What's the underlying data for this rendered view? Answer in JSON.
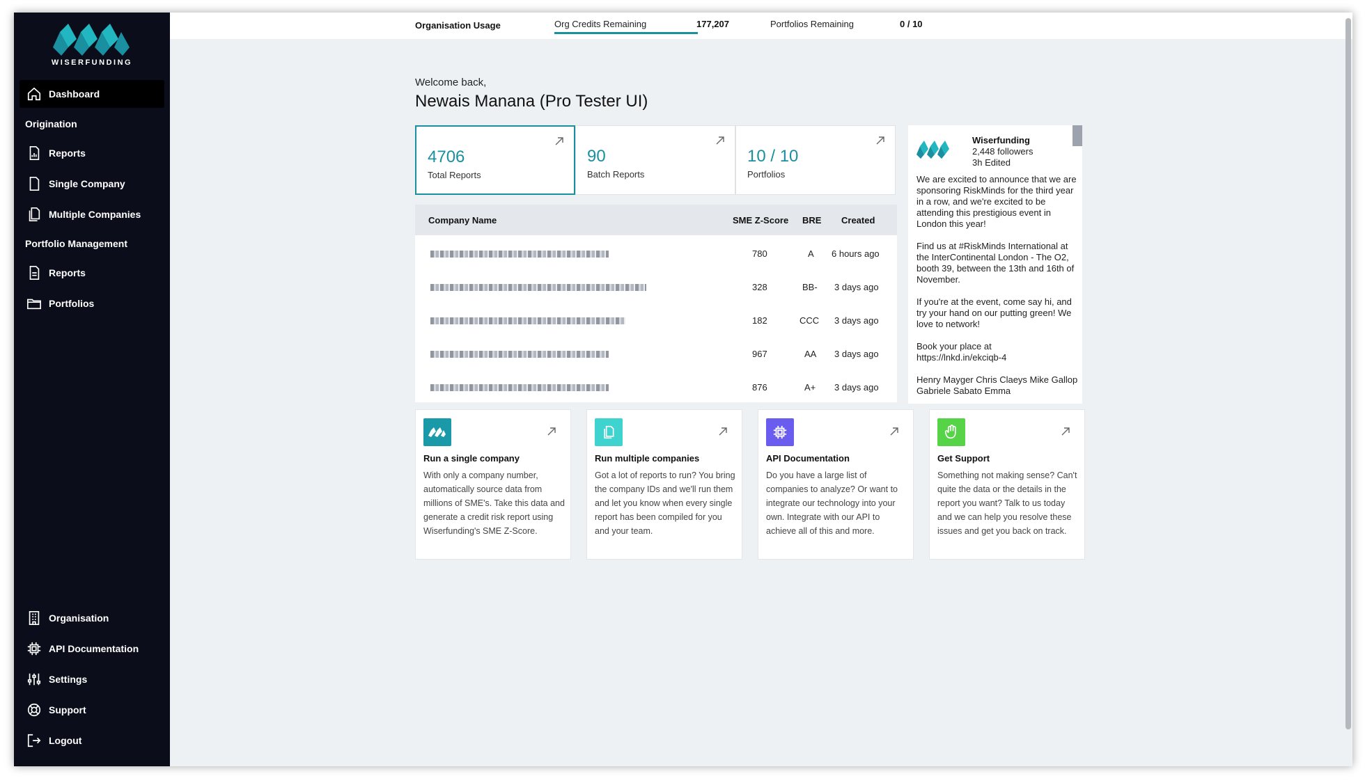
{
  "brand": {
    "name": "WISERFUNDING"
  },
  "sidebar": {
    "dashboard": "Dashboard",
    "section_origination": "Origination",
    "origination_items": [
      "Reports",
      "Single Company",
      "Multiple Companies"
    ],
    "section_portfolio": "Portfolio Management",
    "portfolio_items": [
      "Reports",
      "Portfolios"
    ],
    "bottom_items": [
      "Organisation",
      "API Documentation",
      "Settings",
      "Support",
      "Logout"
    ]
  },
  "topbar": {
    "title": "Organisation Usage",
    "credits_label": "Org Credits Remaining",
    "credits_value": "177,207",
    "portfolios_label": "Portfolios Remaining",
    "portfolios_value": "0 / 10"
  },
  "welcome": {
    "greeting": "Welcome back,",
    "name": "Newais Manana (Pro Tester UI)"
  },
  "stats": [
    {
      "value": "4706",
      "label": "Total Reports"
    },
    {
      "value": "90",
      "label": "Batch Reports"
    },
    {
      "value": "10 / 10",
      "label": "Portfolios"
    }
  ],
  "table": {
    "headers": {
      "company": "Company Name",
      "score": "SME Z-Score",
      "bre": "BRE",
      "created": "Created"
    },
    "rows": [
      {
        "score": "780",
        "bre": "A",
        "created": "6 hours ago"
      },
      {
        "score": "328",
        "bre": "BB-",
        "created": "3 days ago"
      },
      {
        "score": "182",
        "bre": "CCC",
        "created": "3 days ago"
      },
      {
        "score": "967",
        "bre": "AA",
        "created": "3 days ago"
      },
      {
        "score": "876",
        "bre": "A+",
        "created": "3 days ago"
      }
    ]
  },
  "feed": {
    "name": "Wiserfunding",
    "followers": "2,448 followers",
    "edited": "3h Edited",
    "paragraphs": [
      "We are excited to announce that we are sponsoring RiskMinds for the third year in a row, and we're excited to be attending this prestigious event in London this year!",
      "Find us at #RiskMinds International at the InterContinental London - The O2, booth 39, between the 13th and 16th of November.",
      "If you're at the event, come say hi, and try your hand on our putting green! We love to network!",
      "Book your place at https://lnkd.in/ekciqb-4",
      "Henry Mayger Chris Claeys Mike Gallop Gabriele Sabato Emma"
    ]
  },
  "cards": [
    {
      "title": "Run a single company",
      "desc": "With only a company number, automatically source data from millions of SME's. Take this data and generate a credit risk report using Wiserfunding's SME Z-Score.",
      "color": "#1a9aa8",
      "icon": "logo-icon"
    },
    {
      "title": "Run multiple companies",
      "desc": "Got a lot of reports to run? You bring the company IDs and we'll run them and let you know when every single report has been compiled for you and your team.",
      "color": "#3fd3cf",
      "icon": "copy-icon"
    },
    {
      "title": "API Documentation",
      "desc": "Do you have a large list of companies to analyze? Or want to integrate our technology into your own. Integrate with our API to achieve all of this and more.",
      "color": "#6b5cf0",
      "icon": "chip-icon"
    },
    {
      "title": "Get Support",
      "desc": "Something not making sense? Can't quite the data or the details in the report you want? Talk to us today and we can help you resolve these issues and get you back on track.",
      "color": "#57d348",
      "icon": "hand-icon"
    }
  ],
  "colors": {
    "accent": "#1a8fa0",
    "sidebar_bg": "#0b0d1a"
  }
}
